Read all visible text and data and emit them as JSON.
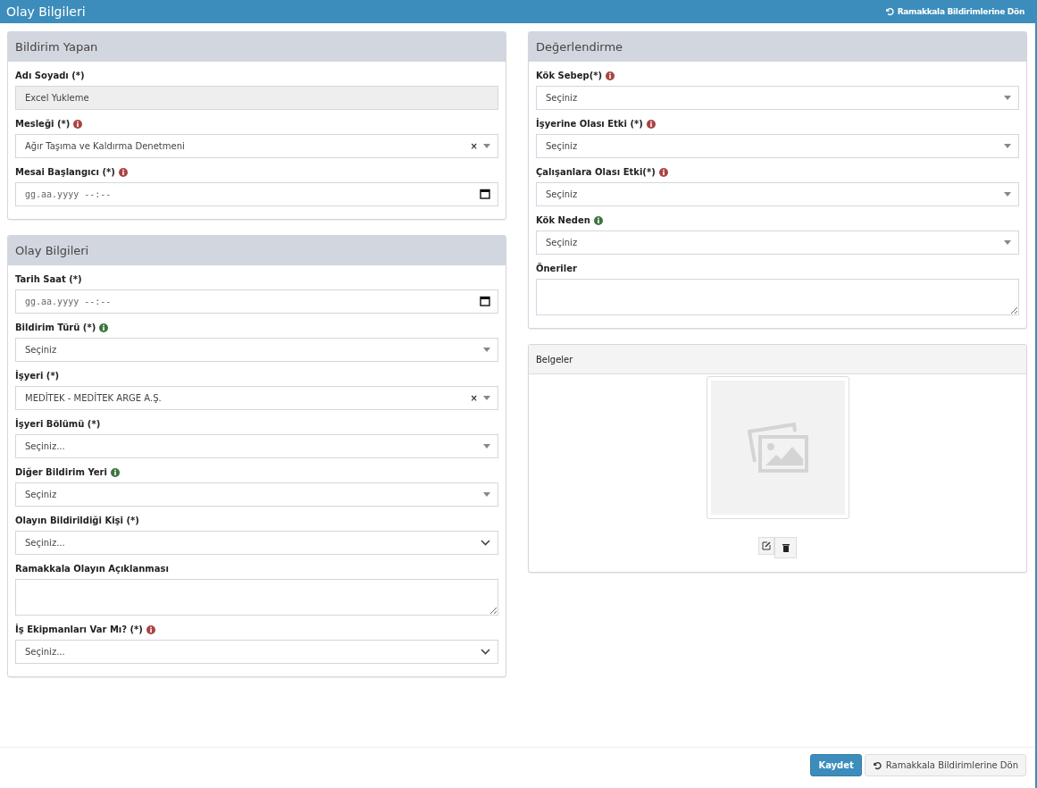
{
  "header": {
    "title": "Olay Bilgileri",
    "back_link": "Ramakkala Bildirimlerine Dön"
  },
  "left_panels": [
    {
      "title": "Bildirim Yapan",
      "fields": [
        {
          "kind": "text",
          "label": "Adı Soyadı (*)",
          "value": "Excel Yukleme",
          "disabled": true
        },
        {
          "kind": "select2",
          "label": "Mesleği (*)",
          "value": "Ağır Taşıma ve Kaldırma Denetmeni",
          "clear": "×",
          "info_icon": {
            "color": "#a94442"
          }
        },
        {
          "kind": "date",
          "label": "Mesai Başlangıcı (*)",
          "placeholder": "gg.aa.yyyy --:--",
          "info_icon": {
            "color": "#a94442"
          }
        }
      ]
    },
    {
      "title": "Olay Bilgileri",
      "fields": [
        {
          "kind": "date",
          "label": "Tarih Saat (*)",
          "placeholder": "gg.aa.yyyy --:--"
        },
        {
          "kind": "select2",
          "label": "Bildirim Türü (*)",
          "value": "Seçiniz",
          "info_icon": {
            "color": "#3c763d"
          }
        },
        {
          "kind": "select2",
          "label": "İşyeri (*)",
          "value": "MEDİTEK - MEDİTEK ARGE A.Ş.",
          "clear": "×"
        },
        {
          "kind": "select2",
          "label": "İşyeri Bölümü (*)",
          "value": "Seçiniz..."
        },
        {
          "kind": "select2",
          "label": "Diğer Bildirim Yeri",
          "value": "Seçiniz",
          "info_icon": {
            "color": "#3c763d"
          }
        },
        {
          "kind": "native",
          "label": "Olayın Bildirildiği Kişi (*)",
          "value": "Seçiniz..."
        },
        {
          "kind": "textarea",
          "label": "Ramakkala Olayın Açıklanması"
        },
        {
          "kind": "native",
          "label": "İş Ekipmanları Var Mı? (*)",
          "value": "Seçiniz...",
          "info_icon": {
            "color": "#a94442"
          }
        }
      ]
    }
  ],
  "right_panel": {
    "title": "Değerlendirme",
    "fields": [
      {
        "kind": "select2",
        "label": "Kök Sebep(*)",
        "value": "Seçiniz",
        "info_icon": {
          "color": "#a94442"
        }
      },
      {
        "kind": "select2",
        "label": "İşyerine Olası Etki (*)",
        "value": "Seçiniz",
        "info_icon": {
          "color": "#a94442"
        }
      },
      {
        "kind": "select2",
        "label": "Çalışanlara Olası Etki(*)",
        "value": "Seçiniz",
        "info_icon": {
          "color": "#a94442"
        }
      },
      {
        "kind": "select2",
        "label": "Kök Neden",
        "value": "Seçiniz",
        "info_icon": {
          "color": "#3c763d"
        }
      },
      {
        "kind": "textarea",
        "label": "Öneriler"
      }
    ]
  },
  "documents": {
    "title": "Belgeler"
  },
  "footer": {
    "save_button": "Kaydet",
    "back_button": "Ramakkala Bildirimlerine Dön"
  }
}
